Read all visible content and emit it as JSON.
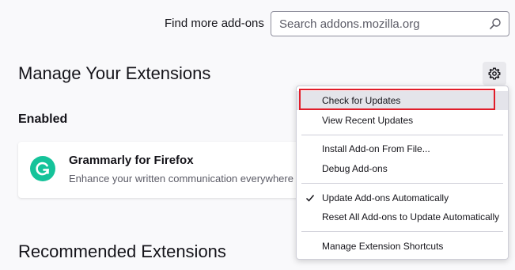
{
  "header": {
    "find_label": "Find more add-ons",
    "search_placeholder": "Search addons.mozilla.org",
    "search_icon": "search-icon"
  },
  "manage": {
    "title": "Manage Your Extensions",
    "gear_icon": "gear-icon"
  },
  "enabled": {
    "title": "Enabled",
    "extensions": [
      {
        "name": "Grammarly for Firefox",
        "description": "Enhance your written communication everywhere",
        "icon": "grammarly-logo",
        "icon_color": "#15c39a"
      }
    ]
  },
  "recommended": {
    "title": "Recommended Extensions"
  },
  "menu": {
    "items": [
      {
        "label": "Check for Updates",
        "highlighted": true
      },
      {
        "label": "View Recent Updates"
      },
      {
        "label": "Install Add-on From File..."
      },
      {
        "label": "Debug Add-ons"
      },
      {
        "label": "Update Add-ons Automatically",
        "checked": true
      },
      {
        "label": "Reset All Add-ons to Update Automatically"
      },
      {
        "label": "Manage Extension Shortcuts"
      }
    ],
    "highlight_color": "#e11d2a"
  }
}
